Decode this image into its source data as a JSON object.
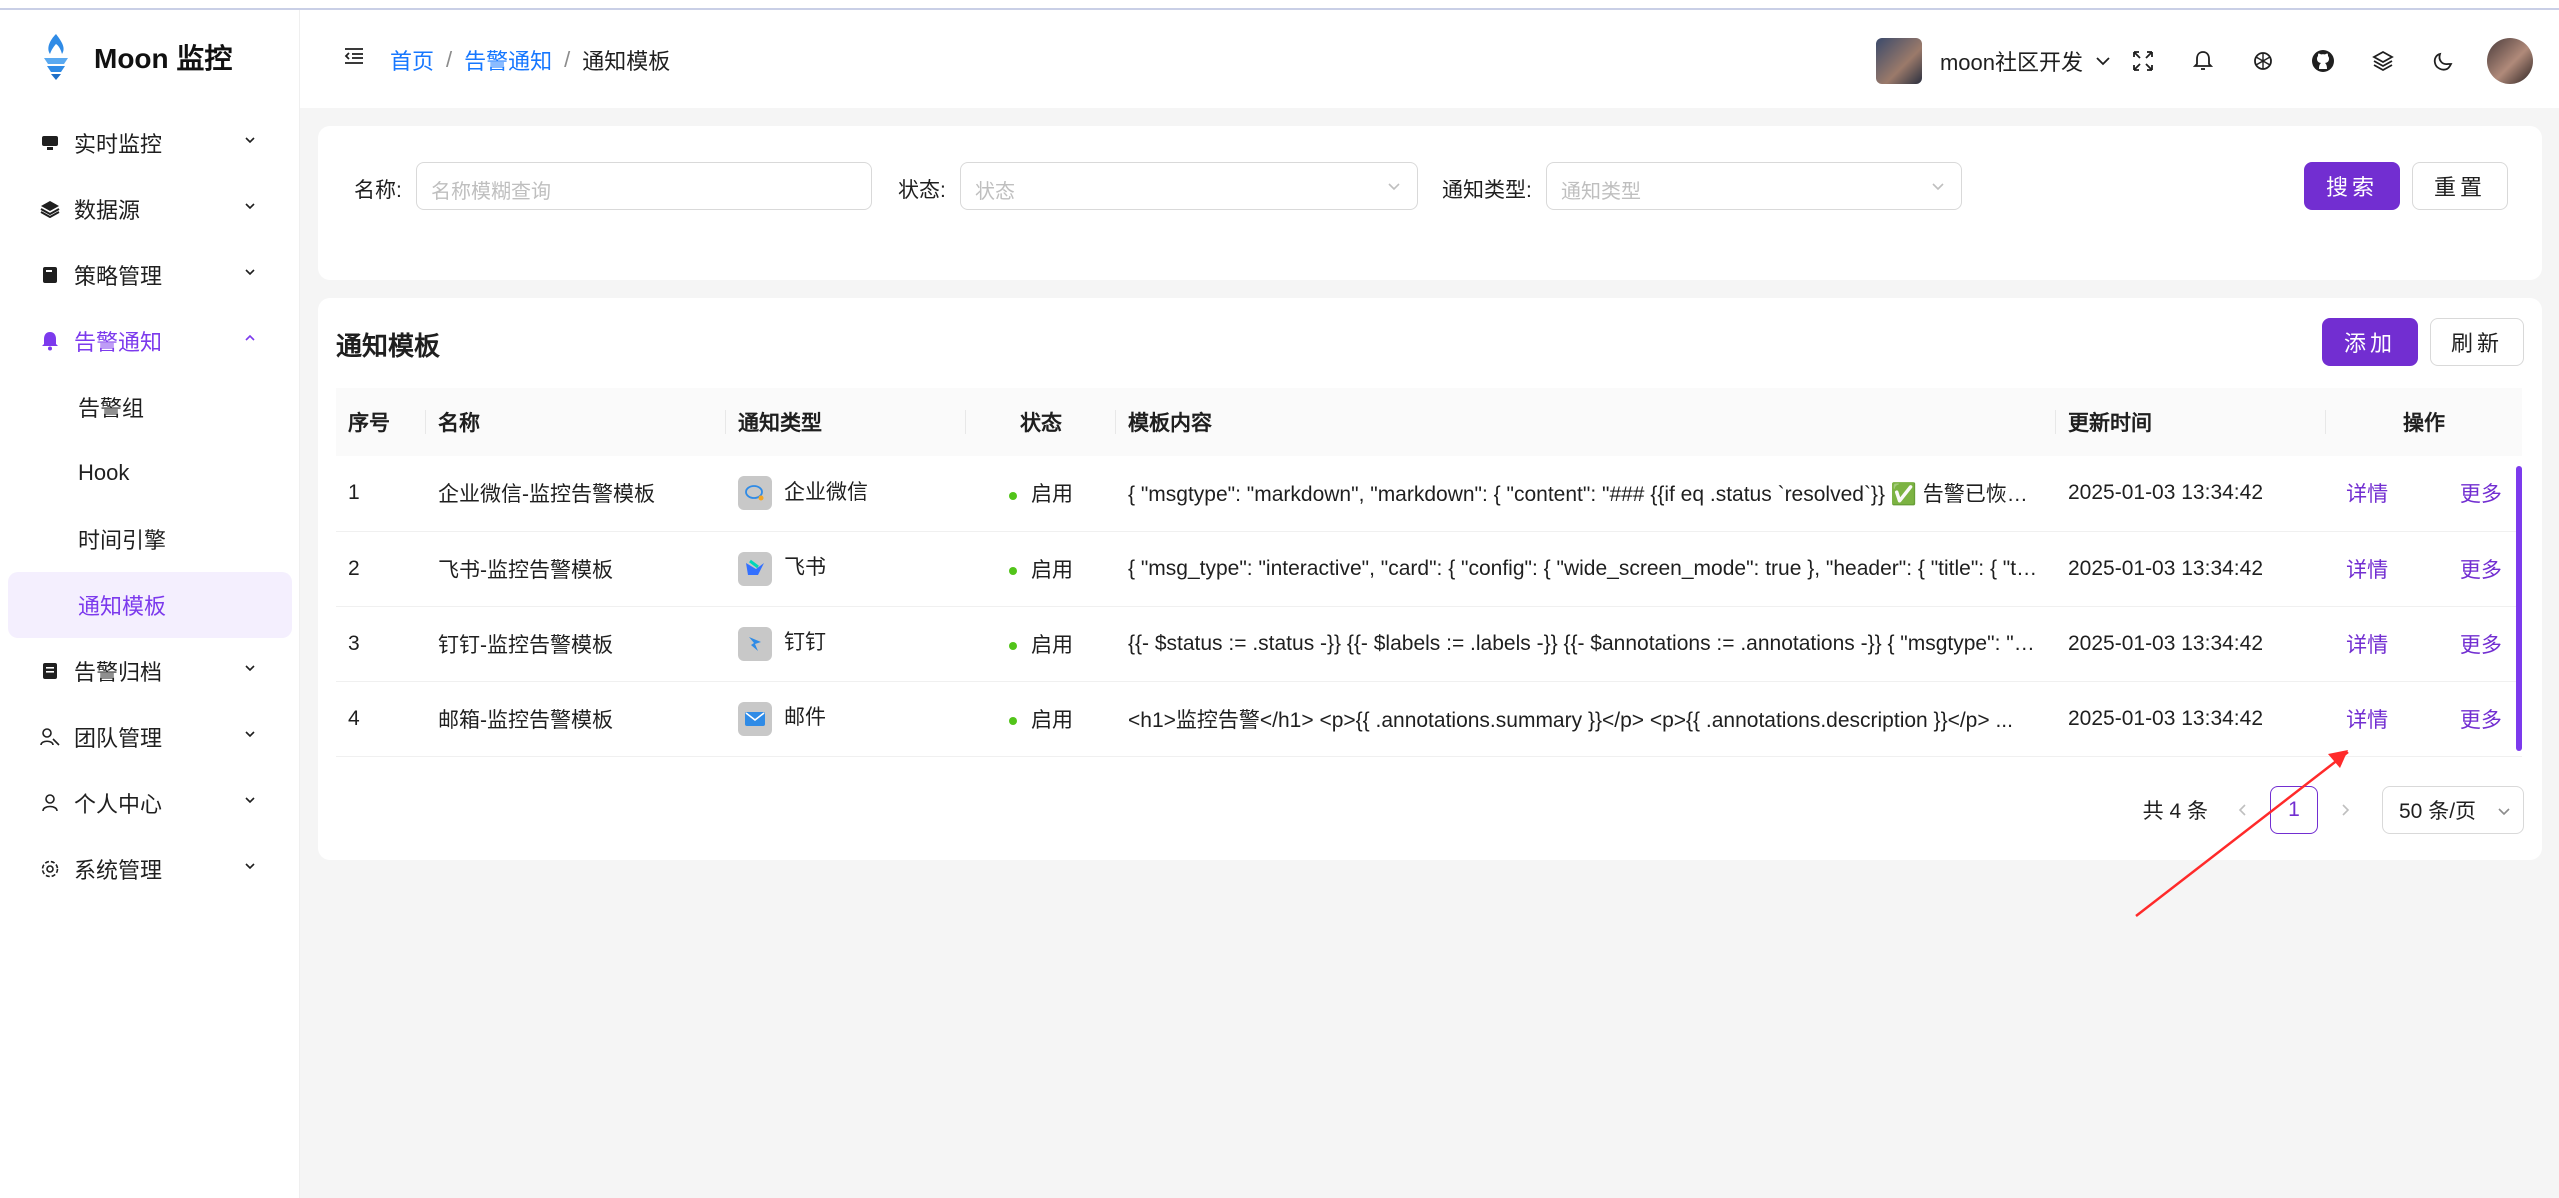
{
  "app": {
    "title": "Moon 监控"
  },
  "sidebar": {
    "items": [
      {
        "label": "实时监控",
        "icon": "monitor-icon"
      },
      {
        "label": "数据源",
        "icon": "layers-icon"
      },
      {
        "label": "策略管理",
        "icon": "book-icon"
      },
      {
        "label": "告警通知",
        "icon": "bell-icon",
        "expanded": true,
        "children": [
          {
            "label": "告警组"
          },
          {
            "label": "Hook"
          },
          {
            "label": "时间引擎"
          },
          {
            "label": "通知模板",
            "selected": true
          }
        ]
      },
      {
        "label": "告警归档",
        "icon": "archive-icon"
      },
      {
        "label": "团队管理",
        "icon": "team-icon"
      },
      {
        "label": "个人中心",
        "icon": "user-icon"
      },
      {
        "label": "系统管理",
        "icon": "settings-icon"
      }
    ]
  },
  "header": {
    "breadcrumb": [
      "首页",
      "告警通知",
      "通知模板"
    ],
    "user": "moon社区开发"
  },
  "filter": {
    "name_label": "名称:",
    "name_placeholder": "名称模糊查询",
    "status_label": "状态:",
    "status_placeholder": "状态",
    "type_label": "通知类型:",
    "type_placeholder": "通知类型",
    "search": "搜索",
    "reset": "重置"
  },
  "table": {
    "title": "通知模板",
    "add": "添加",
    "refresh": "刷新",
    "columns": [
      "序号",
      "名称",
      "通知类型",
      "状态",
      "模板内容",
      "更新时间",
      "操作"
    ],
    "rows": [
      {
        "idx": "1",
        "name": "企业微信-监控告警模板",
        "type": "企业微信",
        "type_icon": "wecom-icon",
        "status": "启用",
        "content": "{ \"msgtype\": \"markdown\", \"markdown\": { \"content\": \"### {{if eq .status `resolved`}} ✅ 告警已恢复...",
        "time": "2025-01-03 13:34:42"
      },
      {
        "idx": "2",
        "name": "飞书-监控告警模板",
        "type": "飞书",
        "type_icon": "feishu-icon",
        "status": "启用",
        "content": "{ \"msg_type\": \"interactive\", \"card\": { \"config\": { \"wide_screen_mode\": true }, \"header\": { \"title\": { \"ta...",
        "time": "2025-01-03 13:34:42"
      },
      {
        "idx": "3",
        "name": "钉钉-监控告警模板",
        "type": "钉钉",
        "type_icon": "dingtalk-icon",
        "status": "启用",
        "content": "{{- $status := .status -}} {{- $labels := .labels -}} {{- $annotations := .annotations -}} { \"msgtype\": \"m...",
        "time": "2025-01-03 13:34:42"
      },
      {
        "idx": "4",
        "name": "邮箱-监控告警模板",
        "type": "邮件",
        "type_icon": "mail-icon",
        "status": "启用",
        "content": "<h1>监控告警</h1> <p>{{ .annotations.summary }}</p> <p>{{ .annotations.description }}</p> ...",
        "time": "2025-01-03 13:34:42"
      }
    ],
    "ops": {
      "detail": "详情",
      "more": "更多"
    }
  },
  "pagination": {
    "total": "共 4 条",
    "page": "1",
    "page_size": "50 条/页"
  },
  "colors": {
    "primary": "#722ed1",
    "link": "#1677ff",
    "status_on": "#52c41a"
  }
}
